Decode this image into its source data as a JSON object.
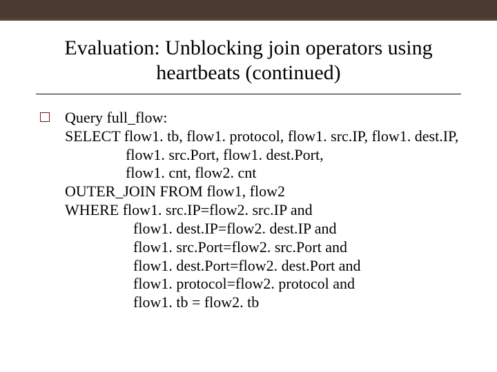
{
  "slide": {
    "title_line1": "Evaluation: Unblocking join operators using",
    "title_line2": "heartbeats (continued)",
    "query": {
      "line1": "Query full_flow:",
      "line2": "SELECT flow1. tb, flow1. protocol, flow1. src.IP, flow1. dest.IP,",
      "line3": "                flow1. src.Port, flow1. dest.Port,",
      "line4": "                flow1. cnt, flow2. cnt",
      "line5": "OUTER_JOIN FROM flow1, flow2",
      "line6": "WHERE flow1. src.IP=flow2. src.IP and",
      "line7": "                  flow1. dest.IP=flow2. dest.IP and",
      "line8": "                  flow1. src.Port=flow2. src.Port and",
      "line9": "                  flow1. dest.Port=flow2. dest.Port and",
      "line10": "                  flow1. protocol=flow2. protocol and",
      "line11": "                  flow1. tb = flow2. tb"
    }
  }
}
